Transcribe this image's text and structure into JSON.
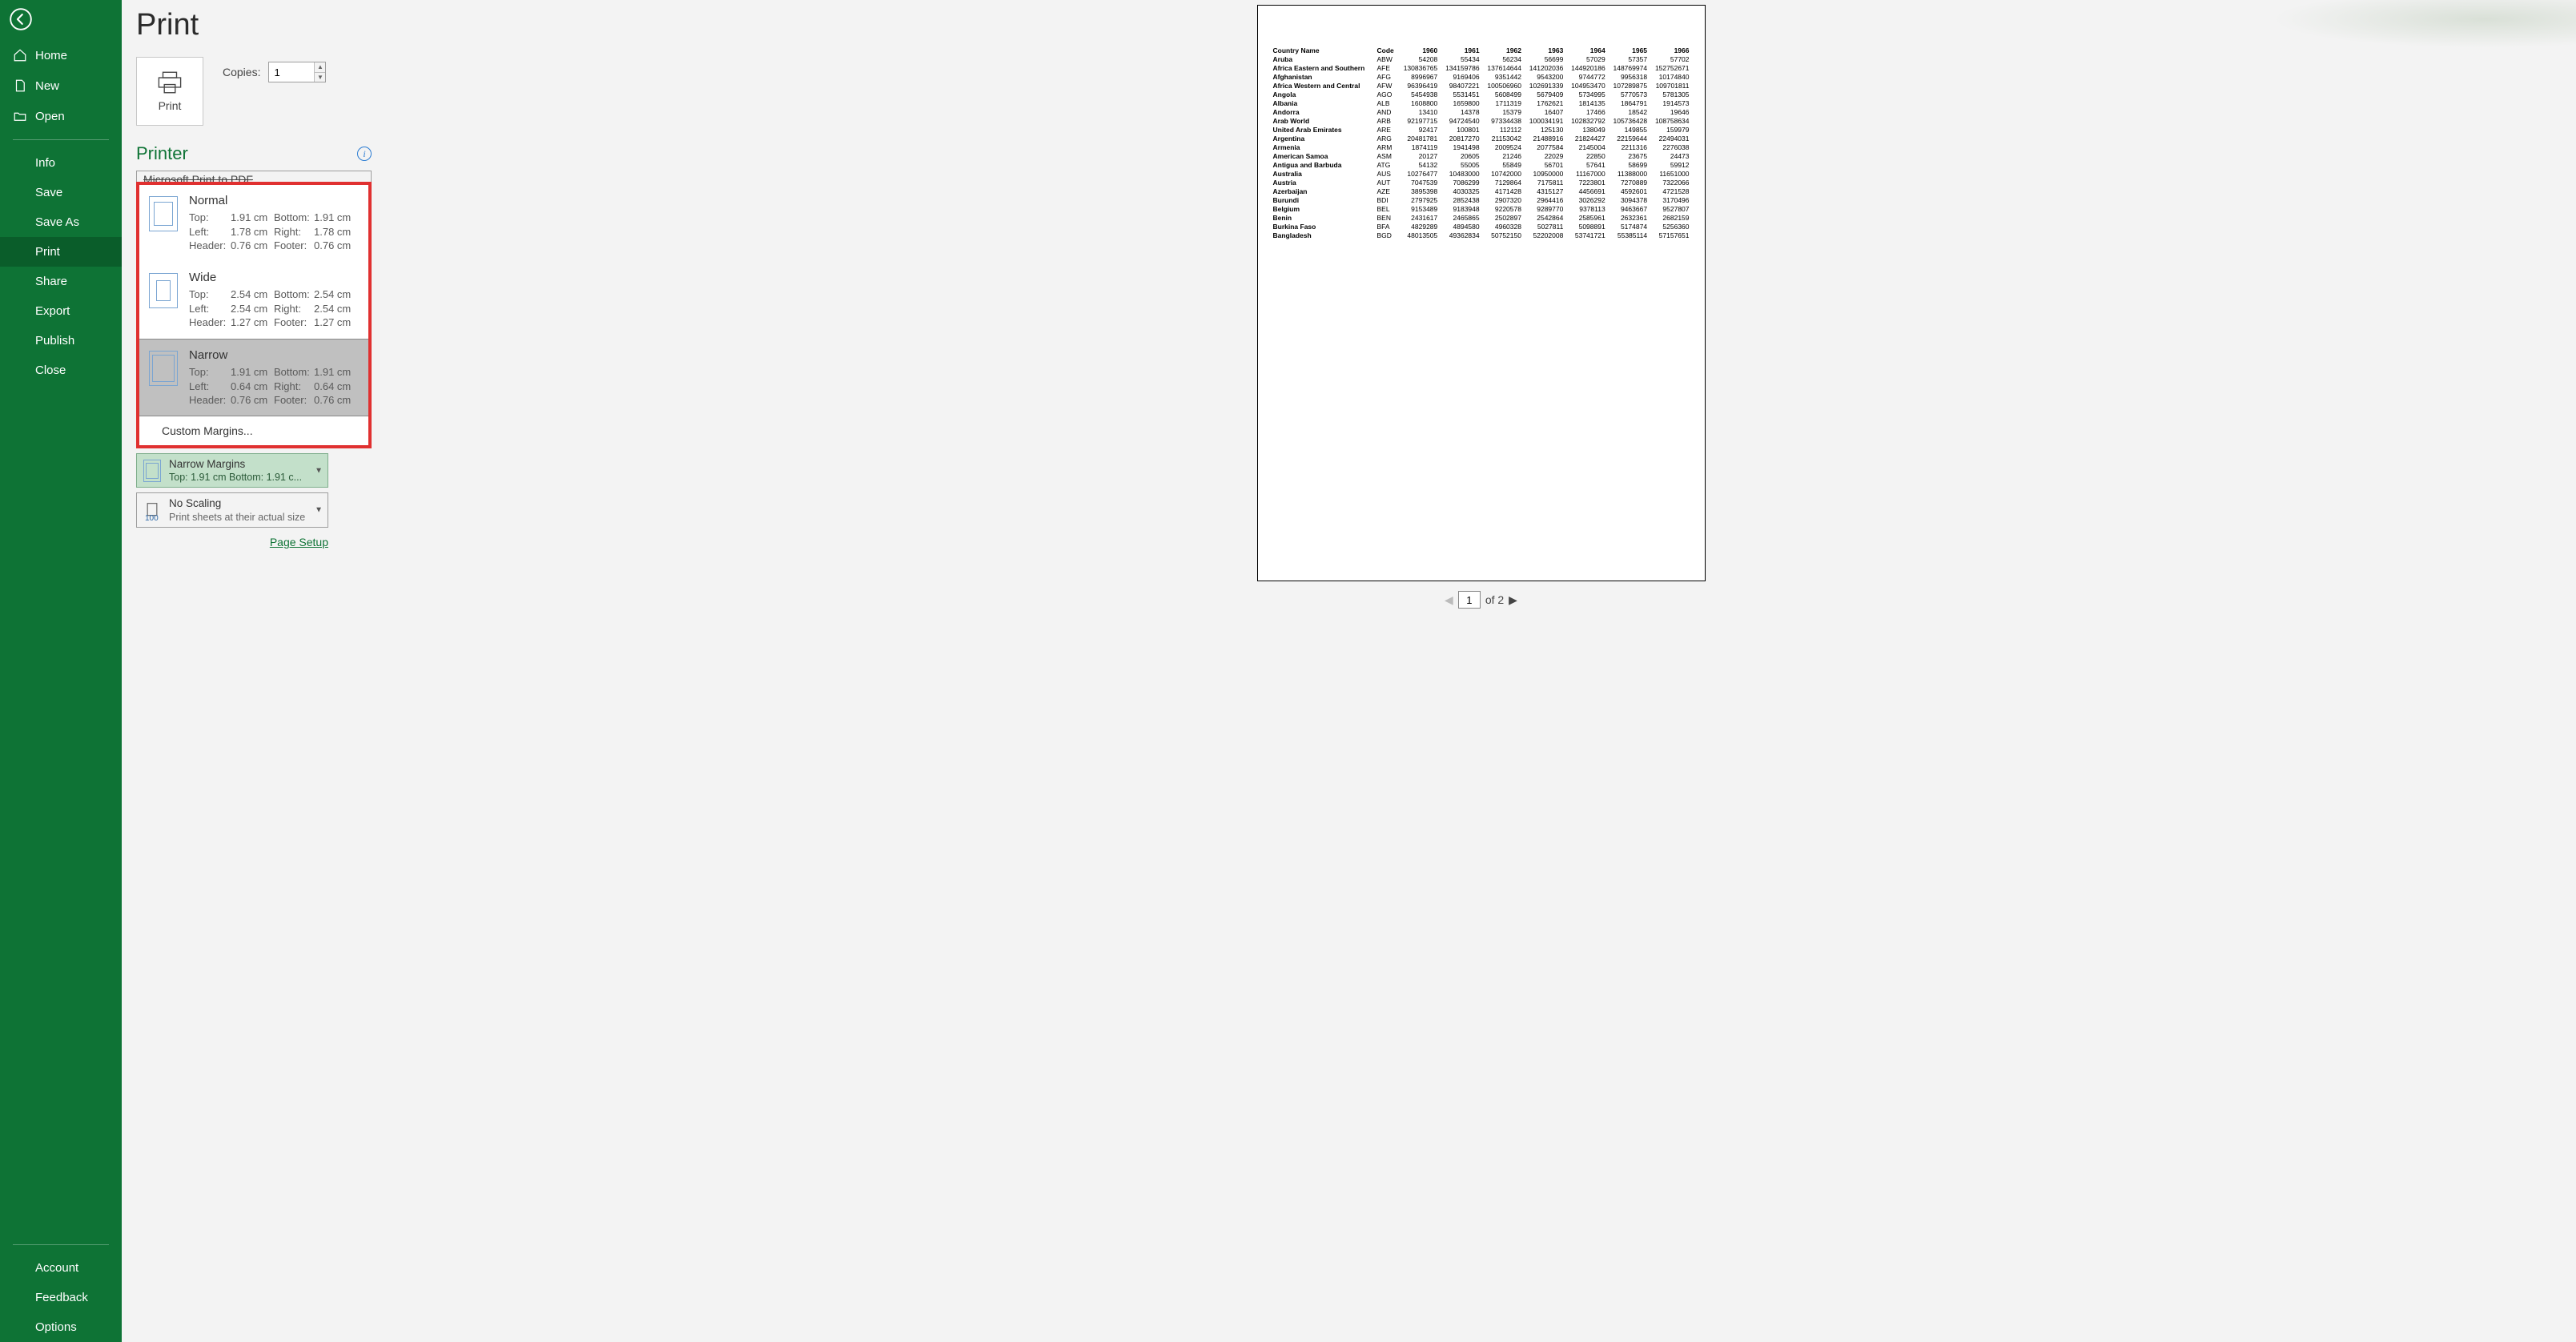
{
  "sidebar": {
    "home": "Home",
    "new": "New",
    "open": "Open",
    "info": "Info",
    "save": "Save",
    "save_as": "Save As",
    "print": "Print",
    "share": "Share",
    "export": "Export",
    "publish": "Publish",
    "close": "Close",
    "account": "Account",
    "feedback": "Feedback",
    "options": "Options"
  },
  "page": {
    "title": "Print",
    "print_button": "Print",
    "copies_label": "Copies:",
    "copies_value": "1",
    "printer_label": "Printer",
    "printer_selected": "Microsoft Print to PDF",
    "page_setup_link": "Page Setup",
    "page_current": "1",
    "page_total": "of 2"
  },
  "margins_popup": {
    "normal": {
      "title": "Normal",
      "top_l": "Top:",
      "top_v": "1.91 cm",
      "bot_l": "Bottom:",
      "bot_v": "1.91 cm",
      "left_l": "Left:",
      "left_v": "1.78 cm",
      "right_l": "Right:",
      "right_v": "1.78 cm",
      "hdr_l": "Header:",
      "hdr_v": "0.76 cm",
      "ftr_l": "Footer:",
      "ftr_v": "0.76 cm"
    },
    "wide": {
      "title": "Wide",
      "top_l": "Top:",
      "top_v": "2.54 cm",
      "bot_l": "Bottom:",
      "bot_v": "2.54 cm",
      "left_l": "Left:",
      "left_v": "2.54 cm",
      "right_l": "Right:",
      "right_v": "2.54 cm",
      "hdr_l": "Header:",
      "hdr_v": "1.27 cm",
      "ftr_l": "Footer:",
      "ftr_v": "1.27 cm"
    },
    "narrow": {
      "title": "Narrow",
      "top_l": "Top:",
      "top_v": "1.91 cm",
      "bot_l": "Bottom:",
      "bot_v": "1.91 cm",
      "left_l": "Left:",
      "left_v": "0.64 cm",
      "right_l": "Right:",
      "right_v": "0.64 cm",
      "hdr_l": "Header:",
      "hdr_v": "0.76 cm",
      "ftr_l": "Footer:",
      "ftr_v": "0.76 cm"
    },
    "custom": "Custom Margins..."
  },
  "settings": {
    "margins_title": "Narrow Margins",
    "margins_sub": "Top: 1.91 cm Bottom: 1.91 c...",
    "scaling_title": "No Scaling",
    "scaling_sub": "Print sheets at their actual size",
    "scaling_num": "100"
  },
  "chart_data": {
    "type": "table",
    "columns": [
      "Country Name",
      "Code",
      "1960",
      "1961",
      "1962",
      "1963",
      "1964",
      "1965",
      "1966"
    ],
    "rows": [
      [
        "Aruba",
        "ABW",
        "54208",
        "55434",
        "56234",
        "56699",
        "57029",
        "57357",
        "57702"
      ],
      [
        "Africa Eastern and Southern",
        "AFE",
        "130836765",
        "134159786",
        "137614644",
        "141202036",
        "144920186",
        "148769974",
        "152752671"
      ],
      [
        "Afghanistan",
        "AFG",
        "8996967",
        "9169406",
        "9351442",
        "9543200",
        "9744772",
        "9956318",
        "10174840"
      ],
      [
        "Africa Western and Central",
        "AFW",
        "96396419",
        "98407221",
        "100506960",
        "102691339",
        "104953470",
        "107289875",
        "109701811"
      ],
      [
        "Angola",
        "AGO",
        "5454938",
        "5531451",
        "5608499",
        "5679409",
        "5734995",
        "5770573",
        "5781305"
      ],
      [
        "Albania",
        "ALB",
        "1608800",
        "1659800",
        "1711319",
        "1762621",
        "1814135",
        "1864791",
        "1914573"
      ],
      [
        "Andorra",
        "AND",
        "13410",
        "14378",
        "15379",
        "16407",
        "17466",
        "18542",
        "19646"
      ],
      [
        "Arab World",
        "ARB",
        "92197715",
        "94724540",
        "97334438",
        "100034191",
        "102832792",
        "105736428",
        "108758634"
      ],
      [
        "United Arab Emirates",
        "ARE",
        "92417",
        "100801",
        "112112",
        "125130",
        "138049",
        "149855",
        "159979"
      ],
      [
        "Argentina",
        "ARG",
        "20481781",
        "20817270",
        "21153042",
        "21488916",
        "21824427",
        "22159644",
        "22494031"
      ],
      [
        "Armenia",
        "ARM",
        "1874119",
        "1941498",
        "2009524",
        "2077584",
        "2145004",
        "2211316",
        "2276038"
      ],
      [
        "American Samoa",
        "ASM",
        "20127",
        "20605",
        "21246",
        "22029",
        "22850",
        "23675",
        "24473"
      ],
      [
        "Antigua and Barbuda",
        "ATG",
        "54132",
        "55005",
        "55849",
        "56701",
        "57641",
        "58699",
        "59912"
      ],
      [
        "Australia",
        "AUS",
        "10276477",
        "10483000",
        "10742000",
        "10950000",
        "11167000",
        "11388000",
        "11651000"
      ],
      [
        "Austria",
        "AUT",
        "7047539",
        "7086299",
        "7129864",
        "7175811",
        "7223801",
        "7270889",
        "7322066"
      ],
      [
        "Azerbaijan",
        "AZE",
        "3895398",
        "4030325",
        "4171428",
        "4315127",
        "4456691",
        "4592601",
        "4721528"
      ],
      [
        "Burundi",
        "BDI",
        "2797925",
        "2852438",
        "2907320",
        "2964416",
        "3026292",
        "3094378",
        "3170496"
      ],
      [
        "Belgium",
        "BEL",
        "9153489",
        "9183948",
        "9220578",
        "9289770",
        "9378113",
        "9463667",
        "9527807"
      ],
      [
        "Benin",
        "BEN",
        "2431617",
        "2465865",
        "2502897",
        "2542864",
        "2585961",
        "2632361",
        "2682159"
      ],
      [
        "Burkina Faso",
        "BFA",
        "4829289",
        "4894580",
        "4960328",
        "5027811",
        "5098891",
        "5174874",
        "5256360"
      ],
      [
        "Bangladesh",
        "BGD",
        "48013505",
        "49362834",
        "50752150",
        "52202008",
        "53741721",
        "55385114",
        "57157651"
      ]
    ]
  }
}
